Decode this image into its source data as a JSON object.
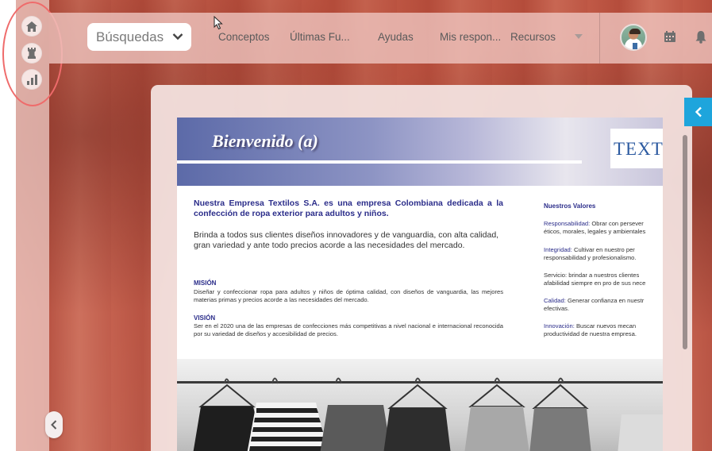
{
  "topbar": {
    "search_select_label": "Búsquedas",
    "nav": [
      "Conceptos",
      "Últimas Fu...",
      "Ayudas",
      "Mis respon...",
      "Recursos"
    ]
  },
  "rail": {
    "icons": [
      "home-icon",
      "chess-rook-icon",
      "bar-chart-icon"
    ]
  },
  "document": {
    "banner_title": "Bienvenido (a)",
    "logo_text": "TEXTI",
    "intro_bold": "Nuestra Empresa Textilos S.A. es una empresa Colombiana dedicada a la confección de ropa exterior para adultos y niños.",
    "intro_text": "Brinda a todos sus clientes diseños innovadores y de vanguardia, con alta calidad, gran variedad y ante todo precios acorde a las necesidades del mercado.",
    "mision_title": "MISIÓN",
    "mision_text": "Diseñar y confeccionar ropa para adultos y niños de óptima calidad, con diseños de vanguardia, las mejores materias primas y precios acorde a las necesidades del mercado.",
    "vision_title": "VISIÓN",
    "vision_text": "Ser en el 2020 una de las empresas de confecciones más competitivas a nivel nacional e internacional reconocida por su variedad de diseños y accesibilidad de precios.",
    "values_title": "Nuestros Valores",
    "values": [
      {
        "key": "Responsabilidad:",
        "text": " Obrar con persever",
        "line2": "éticos, morales, legales y ambientales"
      },
      {
        "key": "Integridad:",
        "text": " Cultivar en nuestro per",
        "line2": "responsabilidad y profesionalismo."
      },
      {
        "key": "",
        "text": "Servicio: brindar a nuestros clientes",
        "line2": "afabilidad siempre en pro de sus nece"
      },
      {
        "key": "Calidad:",
        "text": " Generar confianza en nuestr",
        "line2": "efectivas."
      },
      {
        "key": "Innovación:",
        "text": " Buscar nuevos mecan",
        "line2": "productividad de nuestra empresa."
      }
    ]
  },
  "colors": {
    "accent_tab": "#1ea5dc",
    "highlight_ring": "#ef6b6b",
    "doc_blue": "#2b2d8a"
  }
}
